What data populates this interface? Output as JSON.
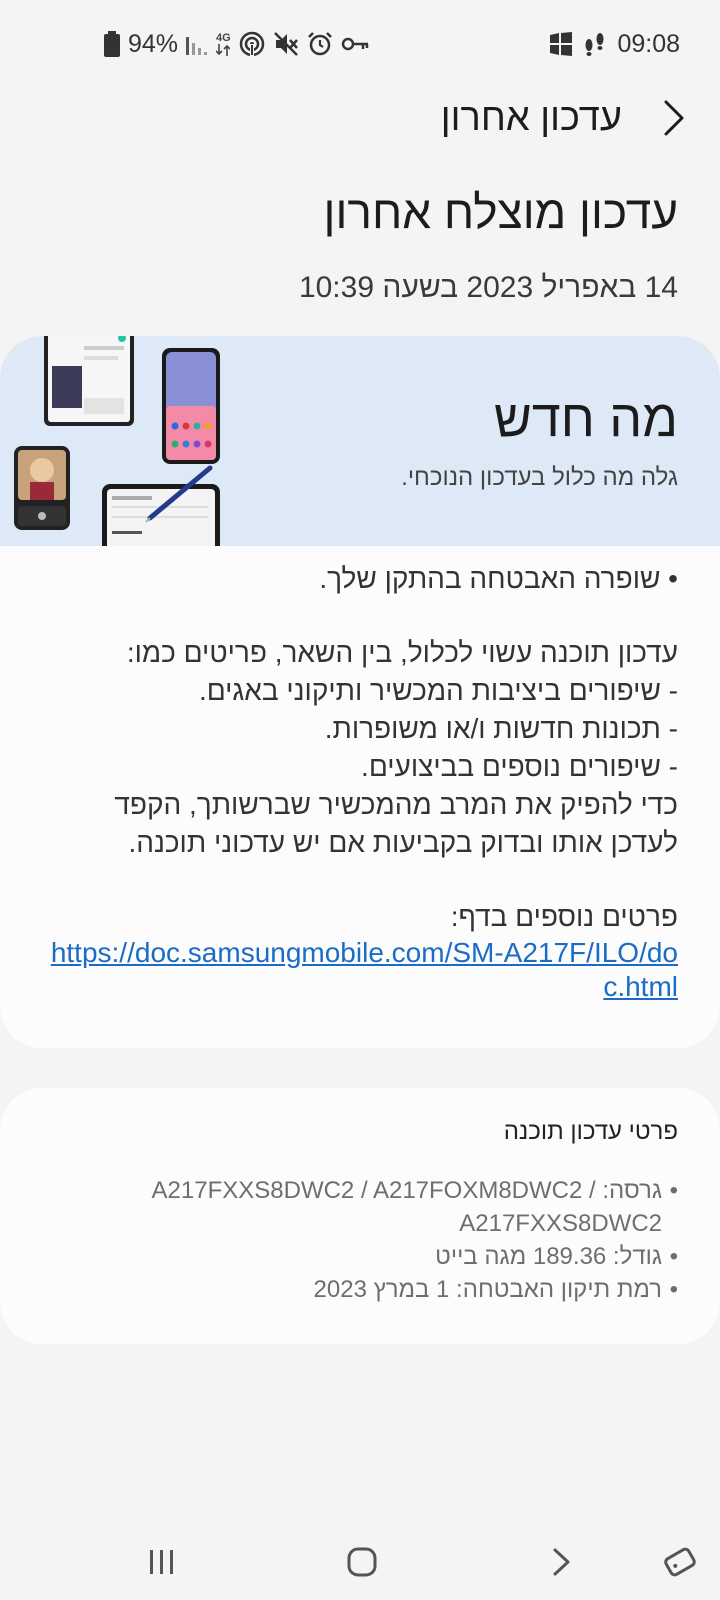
{
  "status_bar": {
    "battery_percent": "94%",
    "network_type": "4G",
    "time": "09:08"
  },
  "header": {
    "title": "עדכון אחרון"
  },
  "last_update": {
    "title": "עדכון מוצלח אחרון",
    "date": "14 באפריל 2023 בשעה 10:39"
  },
  "whats_new": {
    "title": "מה חדש",
    "subtitle": "גלה מה כלול בעדכון הנוכחי.",
    "bullet": "• שופרה האבטחה בהתקן שלך.",
    "intro": "עדכון תוכנה עשוי לכלול, בין השאר, פריטים כמו:",
    "items": [
      "- שיפורים ביציבות המכשיר ותיקוני באגים.",
      "- תכונות חדשות ו/או משופרות.",
      "- שיפורים נוספים בביצועים."
    ],
    "advice_line1": "כדי להפיק את המרב מהמכשיר שברשותך, הקפד",
    "advice_line2": "לעדכן אותו ובדוק בקביעות אם יש עדכוני תוכנה.",
    "more_details_label": "פרטים נוספים בדף:",
    "more_details_link": "https://doc.samsungmobile.com/SM-A217F/ILO/doc.html"
  },
  "software_details": {
    "title": "פרטי עדכון תוכנה",
    "version": "גרסה: A217FXXS8DWC2 / A217FOXM8DWC2 / A217FXXS8DWC2",
    "size": "גודל: 189.36 מגה בייט",
    "security_patch": "רמת תיקון האבטחה: 1 במרץ 2023"
  },
  "colors": {
    "background": "#f4f4f4",
    "banner": "#dde9f6",
    "link": "#1a6cc7"
  },
  "icons": {
    "back": "chevron-right-icon",
    "nav_recents": "recents-icon",
    "nav_home": "home-icon",
    "nav_back": "nav-back-icon",
    "nav_rotate": "rotate-icon"
  }
}
